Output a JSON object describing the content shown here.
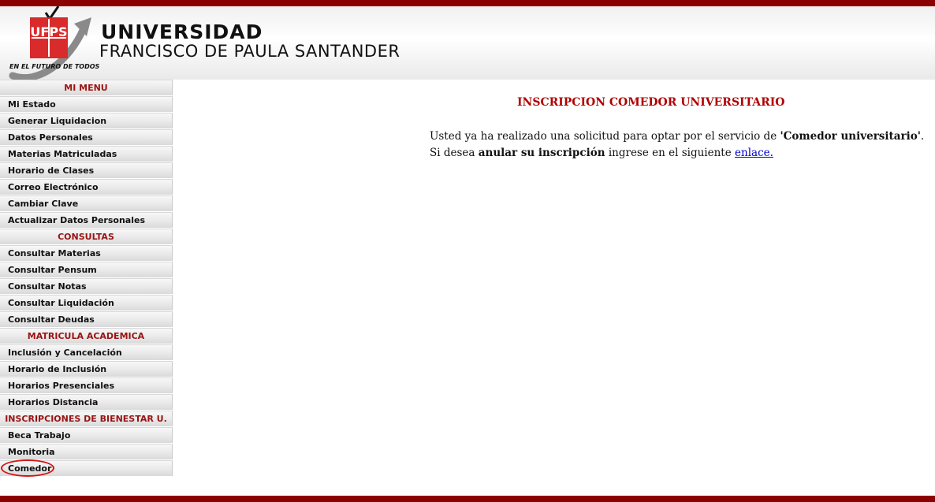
{
  "header": {
    "title_line1": "UNIVERSIDAD",
    "title_line2": "FRANCISCO DE PAULA SANTANDER",
    "logo_text": "UFPS",
    "tagline": "EN EL FUTURO DE TODOS"
  },
  "sidebar": {
    "sections": [
      {
        "title": "MI MENU",
        "items": [
          "Mi Estado",
          "Generar Liquidacion",
          "Datos Personales",
          "Materias Matriculadas",
          "Horario de Clases",
          "Correo Electrónico",
          "Cambiar Clave",
          "Actualizar Datos Personales"
        ]
      },
      {
        "title": "CONSULTAS",
        "items": [
          "Consultar Materias",
          "Consultar Pensum",
          "Consultar Notas",
          "Consultar Liquidación",
          "Consultar Deudas"
        ]
      },
      {
        "title": "MATRICULA ACADEMICA",
        "items": [
          "Inclusión y Cancelación",
          "Horario de Inclusión",
          "Horarios Presenciales",
          "Horarios Distancia"
        ]
      },
      {
        "title": "INSCRIPCIONES DE BIENESTAR U.",
        "items": [
          "Beca Trabajo",
          "Monitoria",
          "Comedor"
        ]
      }
    ]
  },
  "main": {
    "title": "INSCRIPCION COMEDOR UNIVERSITARIO",
    "p1_prefix": "Usted ya ha realizado una solicitud para optar por el servicio de ",
    "p1_bold": "'Comedor universitario'",
    "p1_suffix": ".",
    "p2_prefix": "Si desea ",
    "p2_bold": "anular su inscripción",
    "p2_middle": " ingrese en el siguiente ",
    "p2_link": "enlace."
  },
  "colors": {
    "brand_red": "#8b0000",
    "section_red": "#9a1313",
    "title_red": "#b00000",
    "link_blue": "#0000cc"
  }
}
